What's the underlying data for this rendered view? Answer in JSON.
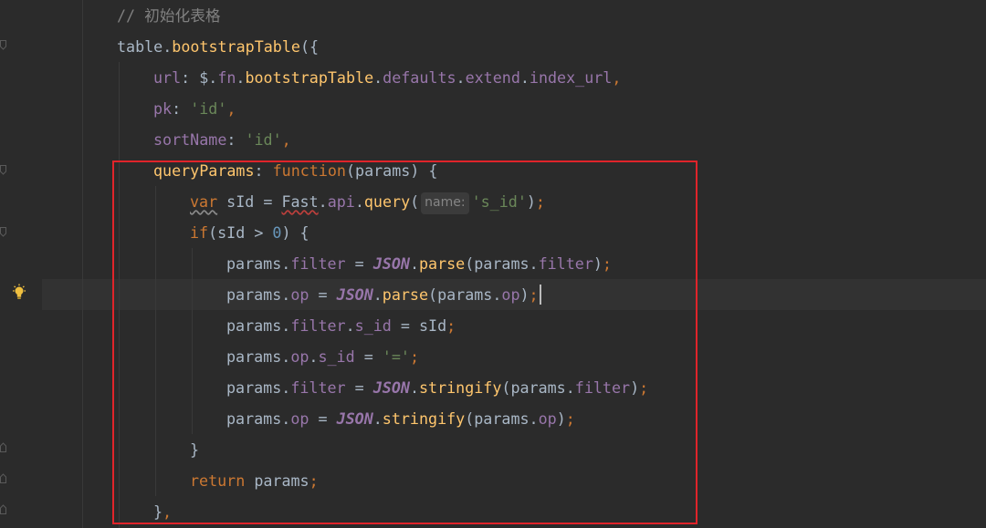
{
  "editor": {
    "lines": [
      {
        "tokens": [
          {
            "t": "// ",
            "c": "comment"
          },
          {
            "t": "初始化表格",
            "c": "comment"
          }
        ]
      },
      {
        "tokens": [
          {
            "t": "table",
            "c": "ident"
          },
          {
            "t": ".",
            "c": "punct"
          },
          {
            "t": "bootstrapTable",
            "c": "method"
          },
          {
            "t": "({",
            "c": "punct"
          }
        ]
      },
      {
        "tokens": [
          {
            "t": "url",
            "c": "prop"
          },
          {
            "t": ": $.",
            "c": "punct"
          },
          {
            "t": "fn",
            "c": "prop"
          },
          {
            "t": ".",
            "c": "punct"
          },
          {
            "t": "bootstrapTable",
            "c": "method"
          },
          {
            "t": ".",
            "c": "punct"
          },
          {
            "t": "defaults",
            "c": "prop"
          },
          {
            "t": ".",
            "c": "punct"
          },
          {
            "t": "extend",
            "c": "prop"
          },
          {
            "t": ".",
            "c": "punct"
          },
          {
            "t": "index_url",
            "c": "prop"
          },
          {
            "t": ",",
            "c": "semi"
          }
        ]
      },
      {
        "tokens": [
          {
            "t": "pk",
            "c": "prop"
          },
          {
            "t": ": ",
            "c": "punct"
          },
          {
            "t": "'id'",
            "c": "string"
          },
          {
            "t": ",",
            "c": "semi"
          }
        ]
      },
      {
        "tokens": [
          {
            "t": "sortName",
            "c": "prop"
          },
          {
            "t": ": ",
            "c": "punct"
          },
          {
            "t": "'id'",
            "c": "string"
          },
          {
            "t": ",",
            "c": "semi"
          }
        ]
      },
      {
        "tokens": [
          {
            "t": "queryParams",
            "c": "method"
          },
          {
            "t": ": ",
            "c": "punct"
          },
          {
            "t": "function",
            "c": "keyword"
          },
          {
            "t": "(params) {",
            "c": "punct"
          }
        ]
      },
      {
        "tokens": [
          {
            "t": "var",
            "c": "keyword-warn"
          },
          {
            "t": " sId = ",
            "c": "ident"
          },
          {
            "t": "Fast",
            "c": "ident-wavy"
          },
          {
            "t": ".",
            "c": "punct"
          },
          {
            "t": "api",
            "c": "prop"
          },
          {
            "t": ".",
            "c": "punct"
          },
          {
            "t": "query",
            "c": "method"
          },
          {
            "t": "(",
            "c": "punct"
          },
          {
            "t": "name:",
            "c": "hint"
          },
          {
            "t": "'s_id'",
            "c": "string"
          },
          {
            "t": ")",
            "c": "punct"
          },
          {
            "t": ";",
            "c": "semi"
          }
        ]
      },
      {
        "tokens": [
          {
            "t": "if",
            "c": "keyword"
          },
          {
            "t": "(sId > ",
            "c": "punct"
          },
          {
            "t": "0",
            "c": "number"
          },
          {
            "t": ") {",
            "c": "punct"
          }
        ]
      },
      {
        "tokens": [
          {
            "t": "params",
            "c": "ident"
          },
          {
            "t": ".",
            "c": "punct"
          },
          {
            "t": "filter",
            "c": "prop"
          },
          {
            "t": " = ",
            "c": "punct"
          },
          {
            "t": "JSON",
            "c": "json"
          },
          {
            "t": ".",
            "c": "punct"
          },
          {
            "t": "parse",
            "c": "method"
          },
          {
            "t": "(params.",
            "c": "punct"
          },
          {
            "t": "filter",
            "c": "prop"
          },
          {
            "t": ")",
            "c": "punct"
          },
          {
            "t": ";",
            "c": "semi"
          }
        ]
      },
      {
        "tokens": [
          {
            "t": "params",
            "c": "ident"
          },
          {
            "t": ".",
            "c": "punct"
          },
          {
            "t": "op",
            "c": "prop"
          },
          {
            "t": " = ",
            "c": "punct"
          },
          {
            "t": "JSON",
            "c": "json"
          },
          {
            "t": ".",
            "c": "punct"
          },
          {
            "t": "parse",
            "c": "method"
          },
          {
            "t": "(params.",
            "c": "punct"
          },
          {
            "t": "op",
            "c": "prop"
          },
          {
            "t": ")",
            "c": "punct"
          },
          {
            "t": ";",
            "c": "semi"
          }
        ],
        "caret": true
      },
      {
        "tokens": [
          {
            "t": "params",
            "c": "ident"
          },
          {
            "t": ".",
            "c": "punct"
          },
          {
            "t": "filter",
            "c": "prop"
          },
          {
            "t": ".",
            "c": "punct"
          },
          {
            "t": "s_id",
            "c": "prop"
          },
          {
            "t": " = sId",
            "c": "punct"
          },
          {
            "t": ";",
            "c": "semi"
          }
        ]
      },
      {
        "tokens": [
          {
            "t": "params",
            "c": "ident"
          },
          {
            "t": ".",
            "c": "punct"
          },
          {
            "t": "op",
            "c": "prop"
          },
          {
            "t": ".",
            "c": "punct"
          },
          {
            "t": "s_id",
            "c": "prop"
          },
          {
            "t": " = ",
            "c": "punct"
          },
          {
            "t": "'='",
            "c": "string"
          },
          {
            "t": ";",
            "c": "semi"
          }
        ]
      },
      {
        "tokens": [
          {
            "t": "params",
            "c": "ident"
          },
          {
            "t": ".",
            "c": "punct"
          },
          {
            "t": "filter",
            "c": "prop"
          },
          {
            "t": " = ",
            "c": "punct"
          },
          {
            "t": "JSON",
            "c": "json"
          },
          {
            "t": ".",
            "c": "punct"
          },
          {
            "t": "stringify",
            "c": "method"
          },
          {
            "t": "(params.",
            "c": "punct"
          },
          {
            "t": "filter",
            "c": "prop"
          },
          {
            "t": ")",
            "c": "punct"
          },
          {
            "t": ";",
            "c": "semi"
          }
        ]
      },
      {
        "tokens": [
          {
            "t": "params",
            "c": "ident"
          },
          {
            "t": ".",
            "c": "punct"
          },
          {
            "t": "op",
            "c": "prop"
          },
          {
            "t": " = ",
            "c": "punct"
          },
          {
            "t": "JSON",
            "c": "json"
          },
          {
            "t": ".",
            "c": "punct"
          },
          {
            "t": "stringify",
            "c": "method"
          },
          {
            "t": "(params.",
            "c": "punct"
          },
          {
            "t": "op",
            "c": "prop"
          },
          {
            "t": ")",
            "c": "punct"
          },
          {
            "t": ";",
            "c": "semi"
          }
        ]
      },
      {
        "tokens": [
          {
            "t": "}",
            "c": "punct"
          }
        ]
      },
      {
        "tokens": [
          {
            "t": "return",
            "c": "keyword"
          },
          {
            "t": " params",
            "c": "ident"
          },
          {
            "t": ";",
            "c": "semi"
          }
        ]
      },
      {
        "tokens": [
          {
            "t": "}",
            "c": "punct"
          },
          {
            "t": ",",
            "c": "semi"
          }
        ]
      }
    ]
  },
  "gutter": {
    "icons": [
      "fold-marker-icon",
      "lightbulb-icon"
    ]
  },
  "colors": {
    "background": "#2b2b2b",
    "highlight_box": "#e0242a",
    "keyword": "#cc7832",
    "string": "#6a8759",
    "property": "#9876aa",
    "method": "#ffc66d",
    "number": "#6897bb",
    "comment": "#808080",
    "default": "#a9b7c6"
  }
}
